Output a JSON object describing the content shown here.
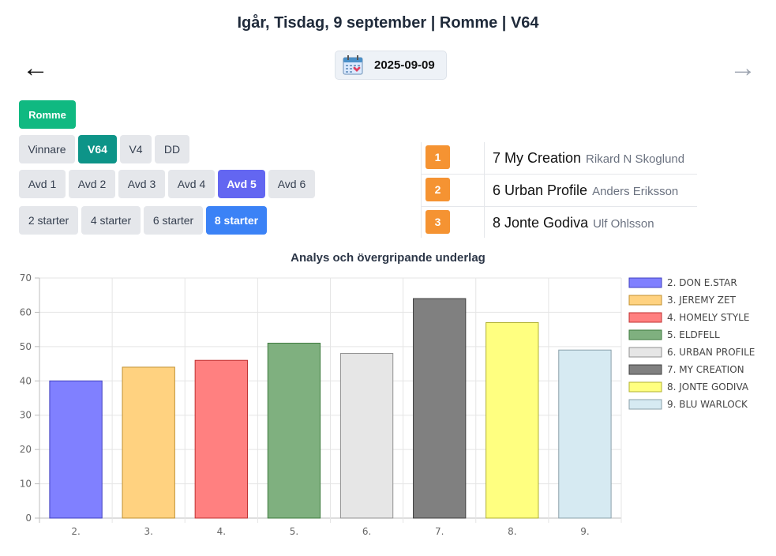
{
  "header": {
    "title": "Igår, Tisdag, 9 september | Romme | V64"
  },
  "nav": {
    "prev_icon": "←",
    "next_icon": "→",
    "date": "2025-09-09"
  },
  "track_button": "Romme",
  "game_types": [
    "Vinnare",
    "V64",
    "V4",
    "DD"
  ],
  "selected_game_type": "V64",
  "races": [
    "Avd 1",
    "Avd 2",
    "Avd 3",
    "Avd 4",
    "Avd 5",
    "Avd 6"
  ],
  "selected_race": "Avd 5",
  "starts": [
    "2 starter",
    "4 starter",
    "6 starter",
    "8 starter"
  ],
  "selected_starts": "8 starter",
  "results": [
    {
      "place": "1",
      "horse": "7 My Creation",
      "driver": "Rikard N Skoglund"
    },
    {
      "place": "2",
      "horse": "6 Urban Profile",
      "driver": "Anders Eriksson"
    },
    {
      "place": "3",
      "horse": "8 Jonte Godiva",
      "driver": "Ulf Ohlsson"
    }
  ],
  "chart_data": {
    "type": "bar",
    "title": "Analys och övergripande underlag",
    "categories": [
      "2.",
      "3.",
      "4.",
      "5.",
      "6.",
      "7.",
      "8.",
      "9."
    ],
    "values": [
      40,
      44,
      46,
      51,
      48,
      64,
      57,
      49
    ],
    "legend": [
      "2. DON E.STAR",
      "3. JEREMY ZET",
      "4. HOMELY STYLE",
      "5. ELDFELL",
      "6. URBAN PROFILE",
      "7. MY CREATION",
      "8. JONTE GODIVA",
      "9. BLU WARLOCK"
    ],
    "colors": [
      "#8080ff",
      "#ffd280",
      "#ff8080",
      "#7fb07f",
      "#e6e6e6",
      "#808080",
      "#ffff80",
      "#d6eaf2"
    ],
    "borders": [
      "#4040c0",
      "#c09030",
      "#c03030",
      "#3d7a3d",
      "#909090",
      "#404040",
      "#b0b030",
      "#8aa0aa"
    ],
    "ylim": [
      0,
      70
    ],
    "yticks": [
      0,
      10,
      20,
      30,
      40,
      50,
      60,
      70
    ],
    "grid": true,
    "legend_position": "right"
  }
}
